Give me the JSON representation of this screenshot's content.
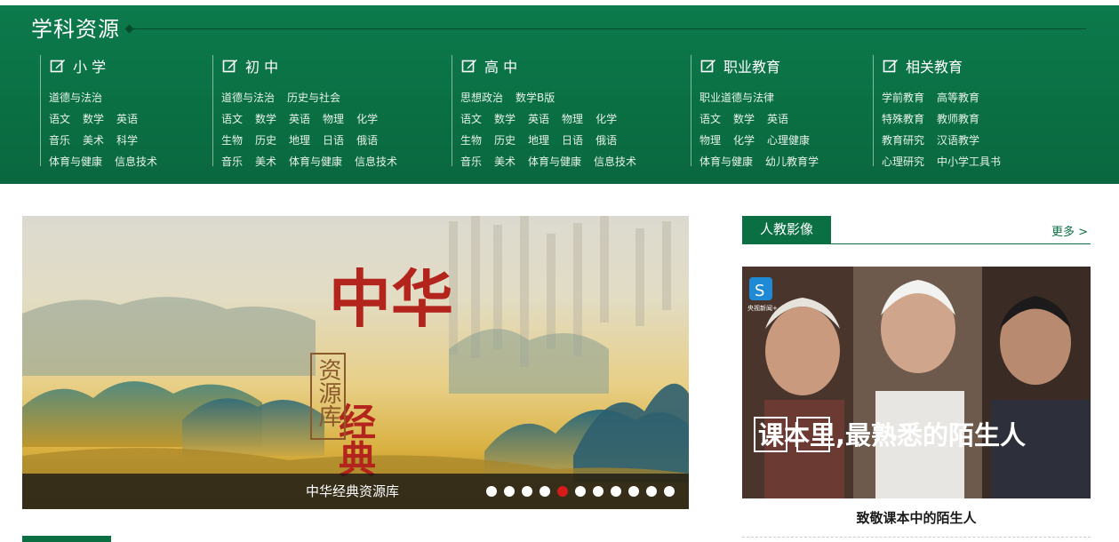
{
  "subjects": {
    "title": "学科资源",
    "columns": [
      {
        "name": "小 学",
        "rows": [
          [
            "道德与法治"
          ],
          [
            "语文",
            "数学",
            "英语"
          ],
          [
            "音乐",
            "美术",
            "科学"
          ],
          [
            "体育与健康",
            "信息技术"
          ]
        ]
      },
      {
        "name": "初 中",
        "rows": [
          [
            "道德与法治",
            "历史与社会"
          ],
          [
            "语文",
            "数学",
            "英语",
            "物理",
            "化学"
          ],
          [
            "生物",
            "历史",
            "地理",
            "日语",
            "俄语"
          ],
          [
            "音乐",
            "美术",
            "体育与健康",
            "信息技术"
          ]
        ]
      },
      {
        "name": "高 中",
        "rows": [
          [
            "思想政治",
            "数学B版"
          ],
          [
            "语文",
            "数学",
            "英语",
            "物理",
            "化学"
          ],
          [
            "生物",
            "历史",
            "地理",
            "日语",
            "俄语"
          ],
          [
            "音乐",
            "美术",
            "体育与健康",
            "信息技术"
          ]
        ]
      },
      {
        "name": "职业教育",
        "rows": [
          [
            "职业道德与法律"
          ],
          [
            "语文",
            "数学",
            "英语"
          ],
          [
            "物理",
            "化学",
            "心理健康"
          ],
          [
            "体育与健康",
            "幼儿教育学"
          ]
        ]
      },
      {
        "name": "相关教育",
        "rows": [
          [
            "学前教育",
            "高等教育"
          ],
          [
            "特殊教育",
            "教师教育"
          ],
          [
            "教育研究",
            "汉语教学"
          ],
          [
            "心理研究",
            "中小学工具书"
          ]
        ]
      }
    ]
  },
  "banner": {
    "caption": "中华经典资源库",
    "image_title": "中华",
    "image_title_2": "经典",
    "image_seal": "资源库",
    "dot_count": 11,
    "active_dot": 5
  },
  "video": {
    "tab": "人教影像",
    "more": "更多 >",
    "thumb_text": "课本里,最熟悉的陌生人",
    "thumb_logo_text": "央视新闻+",
    "title": "致敬课本中的陌生人"
  },
  "colors": {
    "brand_green": "#0a6f43",
    "active_dot": "#d71a1a"
  }
}
